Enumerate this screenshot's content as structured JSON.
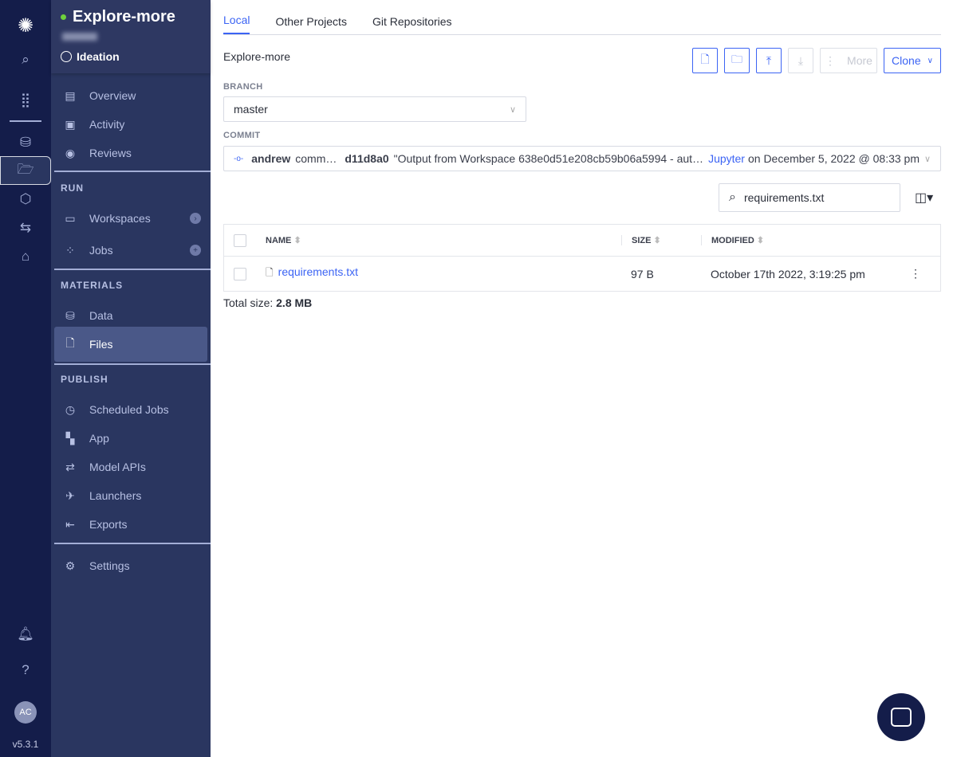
{
  "rail": {
    "version": "v5.3.1",
    "avatar": "AC",
    "icons": [
      "domino-logo-icon",
      "search-icon",
      "apps-grid-icon",
      "database-icon",
      "folder-open-icon",
      "cube-icon",
      "transfer-icon",
      "tag-icon",
      "bell-icon",
      "help-icon"
    ]
  },
  "sidebar": {
    "project": "Explore-more",
    "stage": "Ideation",
    "items": [
      {
        "label": "Overview"
      },
      {
        "label": "Activity"
      },
      {
        "label": "Reviews"
      }
    ],
    "run": {
      "title": "RUN",
      "items": [
        {
          "label": "Workspaces"
        },
        {
          "label": "Jobs"
        }
      ]
    },
    "materials": {
      "title": "MATERIALS",
      "items": [
        {
          "label": "Data"
        },
        {
          "label": "Files"
        }
      ]
    },
    "publish": {
      "title": "PUBLISH",
      "items": [
        {
          "label": "Scheduled Jobs"
        },
        {
          "label": "App"
        },
        {
          "label": "Model APIs"
        },
        {
          "label": "Launchers"
        },
        {
          "label": "Exports"
        }
      ]
    },
    "settings": "Settings"
  },
  "main": {
    "tabs": [
      "Local",
      "Other Projects",
      "Git Repositories"
    ],
    "title": "Explore-more",
    "toolbar": {
      "more": "More",
      "clone": "Clone"
    },
    "branch": {
      "label": "BRANCH",
      "value": "master"
    },
    "commit": {
      "label": "COMMIT",
      "author": "andrew",
      "verb": "comm…",
      "hash": "d11d8a0",
      "message": "\"Output from Workspace 638e0d51e208cb59b06a5994 - aut…",
      "tool": "Jupyter",
      "date": "on December 5, 2022 @ 08:33 pm"
    },
    "search": {
      "value": "requirements.txt"
    },
    "table": {
      "headers": [
        "NAME",
        "SIZE",
        "MODIFIED"
      ],
      "rows": [
        {
          "name": "requirements.txt",
          "size": "97 B",
          "modified": "October 17th 2022, 3:19:25 pm"
        }
      ]
    },
    "total_label": "Total size:",
    "total_value": "2.8 MB"
  },
  "colors": {
    "accent": "#3c64f4",
    "rail": "#141d4a",
    "sidebar": "#2a3660"
  }
}
